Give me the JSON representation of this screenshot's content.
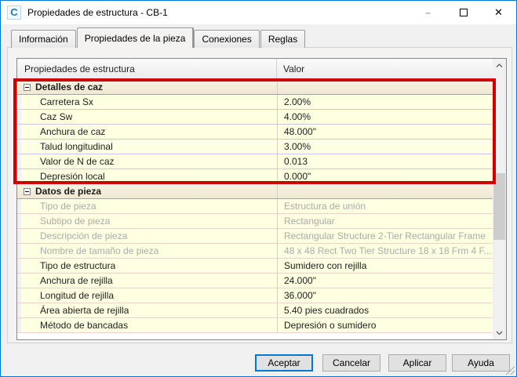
{
  "window": {
    "title": "Propiedades de estructura - CB-1",
    "app_icon_letter": "C",
    "controls": {
      "minimize": "–",
      "maximize": "□",
      "close": "✕"
    }
  },
  "tabs": [
    {
      "label": "Información"
    },
    {
      "label": "Propiedades de la pieza"
    },
    {
      "label": "Conexiones"
    },
    {
      "label": "Reglas"
    }
  ],
  "active_tab": "Propiedades de la pieza",
  "grid": {
    "columns": [
      "Propiedades de estructura",
      "Valor"
    ],
    "rows": [
      {
        "type": "section",
        "label": "Detalles de caz",
        "value": "",
        "group": "caz",
        "highlighted": true
      },
      {
        "type": "item",
        "label": "Carretera Sx",
        "value": "2.00%",
        "group": "caz",
        "readonly": false,
        "highlighted": true
      },
      {
        "type": "item",
        "label": "Caz Sw",
        "value": "4.00%",
        "group": "caz",
        "readonly": false,
        "highlighted": true
      },
      {
        "type": "item",
        "label": "Anchura de caz",
        "value": "48.000\"",
        "group": "caz",
        "readonly": false,
        "highlighted": true
      },
      {
        "type": "item",
        "label": "Talud longitudinal",
        "value": "3.00%",
        "group": "caz",
        "readonly": false,
        "highlighted": true
      },
      {
        "type": "item",
        "label": "Valor de N de caz",
        "value": "0.013",
        "group": "caz",
        "readonly": false,
        "highlighted": true
      },
      {
        "type": "item",
        "label": "Depresión local",
        "value": "0.000\"",
        "group": "caz",
        "readonly": false,
        "highlighted": true
      },
      {
        "type": "section",
        "label": "Datos de pieza",
        "value": "",
        "group": "pieza",
        "highlighted": false
      },
      {
        "type": "item",
        "label": "Tipo de pieza",
        "value": "Estructura de unión",
        "group": "pieza",
        "readonly": true
      },
      {
        "type": "item",
        "label": "Subtipo de pieza",
        "value": "Rectangular",
        "group": "pieza",
        "readonly": true
      },
      {
        "type": "item",
        "label": "Descripción de pieza",
        "value": "Rectangular Structure 2-Tier Rectangular Frame",
        "group": "pieza",
        "readonly": true
      },
      {
        "type": "item",
        "label": "Nombre de tamaño de pieza",
        "value": "48 x 48 Rect Two Tier Structure 18 x 18 Frm 4 F...",
        "group": "pieza",
        "readonly": true
      },
      {
        "type": "item",
        "label": "Tipo de estructura",
        "value": "Sumidero con rejilla",
        "group": "pieza",
        "readonly": false
      },
      {
        "type": "item",
        "label": "Anchura de rejilla",
        "value": "24.000\"",
        "group": "pieza",
        "readonly": false
      },
      {
        "type": "item",
        "label": "Longitud de rejilla",
        "value": "36.000\"",
        "group": "pieza",
        "readonly": false
      },
      {
        "type": "item",
        "label": "Área abierta de rejilla",
        "value": "5.40 pies cuadrados",
        "group": "pieza",
        "readonly": false
      },
      {
        "type": "item",
        "label": "Método de bancadas",
        "value": "Depresión o sumidero",
        "group": "pieza",
        "readonly": false
      }
    ]
  },
  "footer": {
    "buttons": [
      {
        "label": "Aceptar",
        "default": true
      },
      {
        "label": "Cancelar",
        "default": false
      },
      {
        "label": "Aplicar",
        "default": false
      },
      {
        "label": "Ayuda",
        "default": false
      }
    ]
  },
  "colors": {
    "window_border": "#0078D7",
    "row_background": "#FFFFE1",
    "section_background": "#F1EBD8",
    "highlight_box": "#D10000",
    "readonly_text": "#ABABAB",
    "caz_gridline": "#C9C9E3",
    "pieza_gridline": "#F2CFCF",
    "focus_border": "#0078D7"
  }
}
